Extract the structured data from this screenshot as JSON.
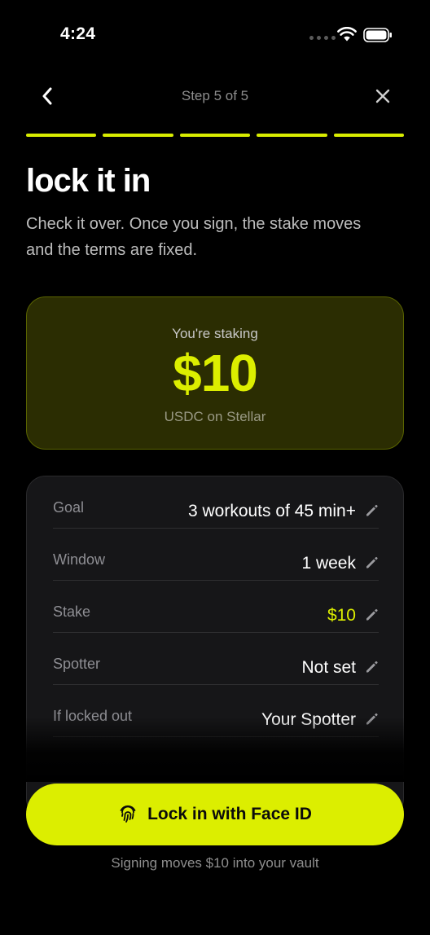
{
  "status_bar": {
    "time": "4:24"
  },
  "nav": {
    "step_label": "Step 5 of 5"
  },
  "progress": {
    "total_steps": 5,
    "completed_steps": 5,
    "accent_color": "#dcee00"
  },
  "header": {
    "title": "lock it in",
    "subtitle": "Check it over. Once you sign, the stake moves and the terms are fixed."
  },
  "stake_card": {
    "label": "You're staking",
    "amount": "$10",
    "network": "USDC on Stellar"
  },
  "details": {
    "rows": [
      {
        "label": "Goal",
        "value": "3 workouts of 45 min+"
      },
      {
        "label": "Window",
        "value": "1 week"
      },
      {
        "label": "Stake",
        "value": "$10"
      },
      {
        "label": "Spotter",
        "value": "Not set"
      },
      {
        "label": "If locked out",
        "value": "Your Spotter"
      }
    ]
  },
  "cta": {
    "label": "Lock in with Face ID",
    "icon": "fingerprint-icon"
  },
  "footnote": "Signing moves $10 into your vault"
}
